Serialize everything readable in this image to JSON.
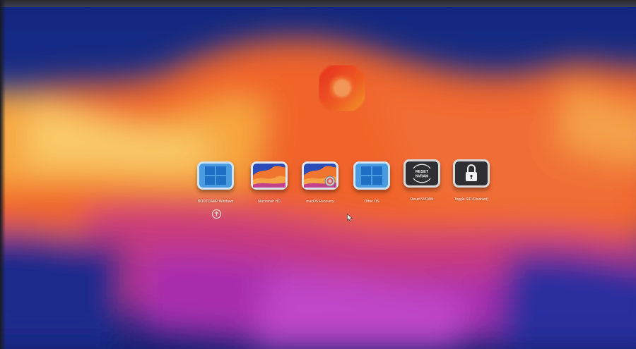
{
  "boot_picker": {
    "entries": [
      {
        "label": "BOOTCAMP Windows",
        "icon": "windows-logo-icon",
        "selected": true
      },
      {
        "label": "Macintosh HD",
        "icon": "macos-wallpaper-icon"
      },
      {
        "label": "macOS Recovery",
        "icon": "macos-recovery-icon"
      },
      {
        "label": "Other OS",
        "icon": "windows-logo-icon"
      },
      {
        "label": "Reset NVRAM",
        "icon": "reset-nvram-icon",
        "badge": "RESET NVRAM"
      },
      {
        "label": "Toggle SIP (Disabled)",
        "icon": "lock-icon"
      }
    ],
    "selector_icon": "power-arrow-icon",
    "logo_icon": "opencore-logo-icon"
  },
  "colors": {
    "background_blue": "#1b2f8f",
    "wallpaper_orange": "#f0642a",
    "wallpaper_magenta": "#b42fa0",
    "logo_red": "#e8361f",
    "logo_orange": "#f38a2a",
    "windows_blue": "#3e8fd8"
  }
}
